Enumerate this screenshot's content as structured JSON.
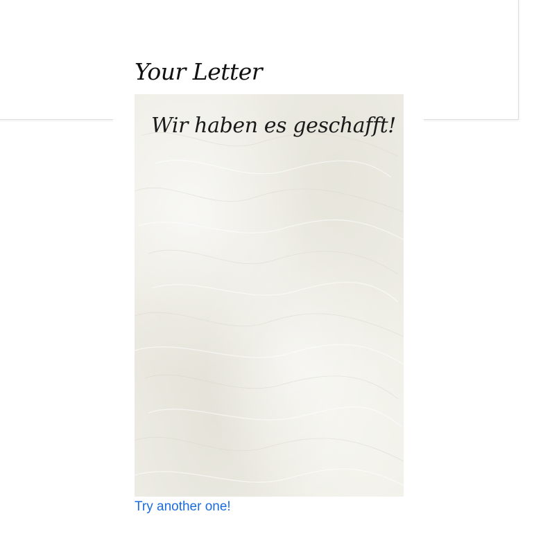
{
  "letter": {
    "heading": "Your Letter",
    "text": "Wir haben es geschafft!"
  },
  "actions": {
    "try_another_label": "Try another one!"
  },
  "colors": {
    "link": "#1a6bde",
    "paper": "#efeee7",
    "text": "#1a1a1a"
  }
}
